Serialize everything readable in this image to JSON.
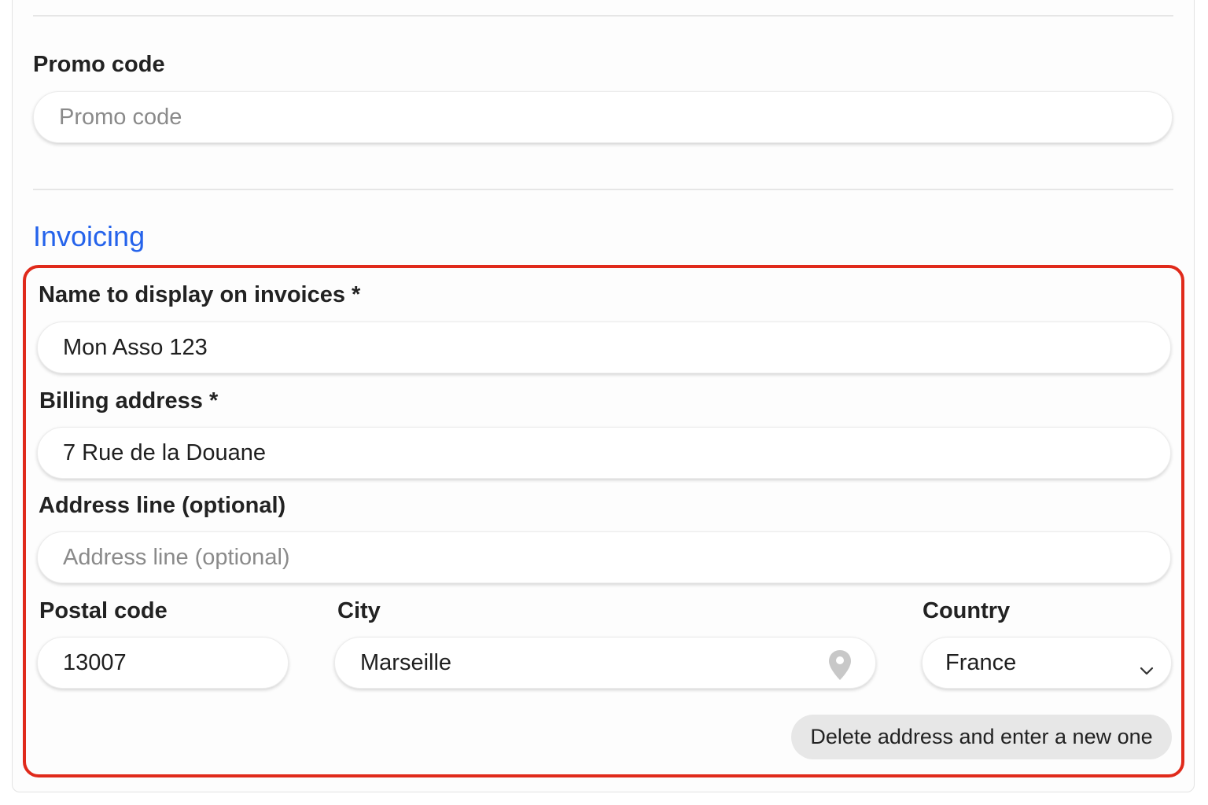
{
  "promo": {
    "label": "Promo code",
    "placeholder": "Promo code"
  },
  "invoicing": {
    "title": "Invoicing",
    "title_color": "#2563eb",
    "highlight_color": "#e02a1b",
    "name": {
      "label": "Name to display on invoices *",
      "value": "Mon Asso 123"
    },
    "billing_address": {
      "label": "Billing address *",
      "value": "7 Rue de la Douane"
    },
    "address_line": {
      "label": "Address line (optional)",
      "placeholder": "Address line (optional)"
    },
    "postal_code": {
      "label": "Postal code",
      "value": "13007"
    },
    "city": {
      "label": "City",
      "value": "Marseille",
      "icon": "location-pin-icon"
    },
    "country": {
      "label": "Country",
      "value": "France",
      "icon": "chevron-down-icon"
    },
    "delete_button": "Delete address and enter a new one"
  }
}
